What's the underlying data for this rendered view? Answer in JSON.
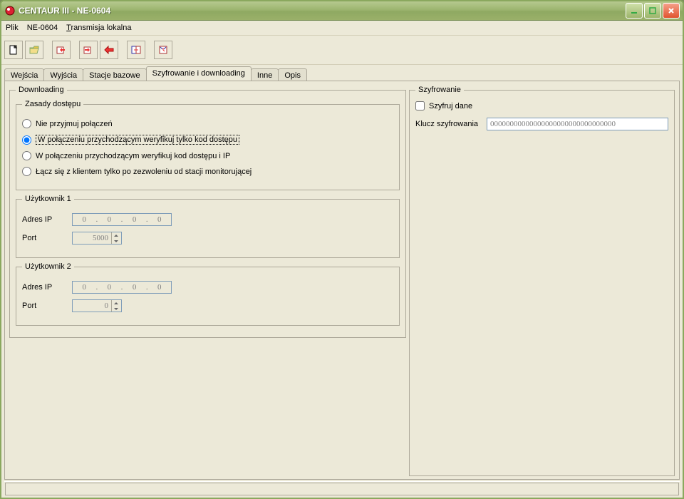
{
  "window": {
    "title": "CENTAUR III -  NE-0604"
  },
  "menu": {
    "plik": "Plik",
    "ne": "NE-0604",
    "trans": "Transmisja lokalna",
    "trans_ul": "T"
  },
  "tabs": {
    "wejscia": "Wejścia",
    "wyjscia": "Wyjścia",
    "stacje": "Stacje bazowe",
    "szyfr": "Szyfrowanie i downloading",
    "inne": "Inne",
    "opis": "Opis"
  },
  "downloading": {
    "legend": "Downloading",
    "zasady": {
      "legend": "Zasady dostępu",
      "opt1": "Nie przyjmuj połączeń",
      "opt2": "W połączeniu przychodzącym weryfikuj tylko kod dostępu",
      "opt3": "W połączeniu przychodzącym weryfikuj kod dostępu i IP",
      "opt4": "Łącz się z klientem tylko po zezwoleniu od stacji monitorującej"
    },
    "user1": {
      "legend": "Użytkownik 1",
      "ip_label": "Adres IP",
      "ip": [
        "0",
        "0",
        "0",
        "0"
      ],
      "port_label": "Port",
      "port": "5000"
    },
    "user2": {
      "legend": "Użytkownik 2",
      "ip_label": "Adres IP",
      "ip": [
        "0",
        "0",
        "0",
        "0"
      ],
      "port_label": "Port",
      "port": "0"
    }
  },
  "encryption": {
    "legend": "Szyfrowanie",
    "chk_label": "Szyfruj dane",
    "key_label": "Klucz szyfrowania",
    "key_value": "00000000000000000000000000000000"
  }
}
